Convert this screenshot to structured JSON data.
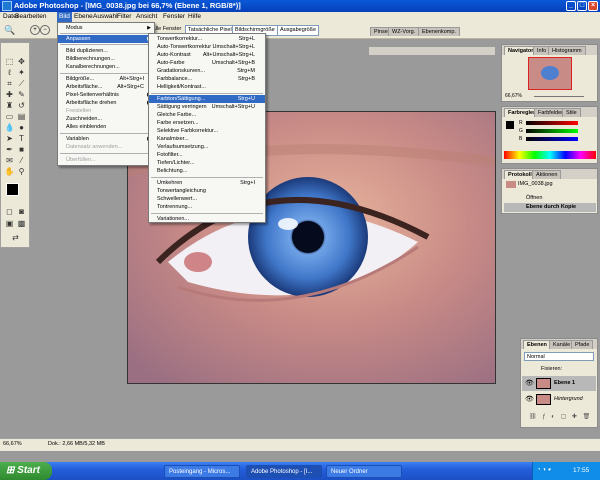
{
  "title": "Adobe Photoshop - [IMG_0038.jpg bei 66,7% (Ebene 1, RGB/8*)]",
  "window_controls": {
    "minimize": "_",
    "maximize": "□",
    "close": "×"
  },
  "menubar": [
    "Datei",
    "Bearbeiten",
    "Bild",
    "Ebene",
    "Auswahl",
    "Filter",
    "Ansicht",
    "Fenster",
    "Hilfe"
  ],
  "options_bar": {
    "all_windows": "Alle Fenster",
    "buttons": [
      "Tatsächliche Pixel",
      "Bildschirmgröße",
      "Ausgabegröße"
    ]
  },
  "image_menu": {
    "items": [
      {
        "label": "Modus",
        "shortcut": "",
        "submenu": true,
        "state": "normal"
      },
      {
        "label": "Anpassen",
        "shortcut": "",
        "submenu": true,
        "state": "highlighted"
      },
      {
        "label": "Bild duplizieren...",
        "shortcut": "",
        "state": "normal"
      },
      {
        "label": "Bildberechnungen...",
        "shortcut": "",
        "state": "normal"
      },
      {
        "label": "Kanalberechnungen...",
        "shortcut": "",
        "state": "normal"
      },
      {
        "label": "Bildgröße...",
        "shortcut": "Alt+Strg+I",
        "state": "normal"
      },
      {
        "label": "Arbeitsfläche...",
        "shortcut": "Alt+Strg+C",
        "state": "normal"
      },
      {
        "label": "Pixel-Seitenverhältnis",
        "shortcut": "",
        "submenu": true,
        "state": "normal"
      },
      {
        "label": "Arbeitsfläche drehen",
        "shortcut": "",
        "submenu": true,
        "state": "normal"
      },
      {
        "label": "Freistellen",
        "shortcut": "",
        "state": "disabled"
      },
      {
        "label": "Zuschneiden...",
        "shortcut": "",
        "state": "normal"
      },
      {
        "label": "Alles einblenden",
        "shortcut": "",
        "state": "normal"
      },
      {
        "label": "Variablen",
        "shortcut": "",
        "submenu": true,
        "state": "normal"
      },
      {
        "label": "Datensatz anwenden...",
        "shortcut": "",
        "state": "disabled"
      },
      {
        "label": "Überfüllen...",
        "shortcut": "",
        "state": "disabled"
      }
    ]
  },
  "adjust_menu": {
    "items": [
      {
        "label": "Tonwertkorrektur...",
        "shortcut": "Strg+L",
        "state": "normal"
      },
      {
        "label": "Auto-Tonwertkorrektur",
        "shortcut": "Umschalt+Strg+L",
        "state": "normal"
      },
      {
        "label": "Auto-Kontrast",
        "shortcut": "Alt+Umschalt+Strg+L",
        "state": "normal"
      },
      {
        "label": "Auto-Farbe",
        "shortcut": "Umschalt+Strg+B",
        "state": "normal"
      },
      {
        "label": "Gradationskurven...",
        "shortcut": "Strg+M",
        "state": "normal"
      },
      {
        "label": "Farbbalance...",
        "shortcut": "Strg+B",
        "state": "normal"
      },
      {
        "label": "Helligkeit/Kontrast...",
        "shortcut": "",
        "state": "normal"
      },
      {
        "label": "Farbton/Sättigung...",
        "shortcut": "Strg+U",
        "state": "highlighted"
      },
      {
        "label": "Sättigung verringern",
        "shortcut": "Umschalt+Strg+U",
        "state": "normal"
      },
      {
        "label": "Gleiche Farbe...",
        "shortcut": "",
        "state": "normal"
      },
      {
        "label": "Farbe ersetzen...",
        "shortcut": "",
        "state": "normal"
      },
      {
        "label": "Selektive Farbkorrektur...",
        "shortcut": "",
        "state": "normal"
      },
      {
        "label": "Kanalmixer...",
        "shortcut": "",
        "state": "normal"
      },
      {
        "label": "Verlaufsumsetzung...",
        "shortcut": "",
        "state": "normal"
      },
      {
        "label": "Fotofilter...",
        "shortcut": "",
        "state": "normal"
      },
      {
        "label": "Tiefen/Lichter...",
        "shortcut": "",
        "state": "normal"
      },
      {
        "label": "Belichtung...",
        "shortcut": "",
        "state": "normal"
      },
      {
        "label": "Umkehren",
        "shortcut": "Strg+I",
        "state": "normal"
      },
      {
        "label": "Tonwertangleichung",
        "shortcut": "",
        "state": "normal"
      },
      {
        "label": "Schwellenwert...",
        "shortcut": "",
        "state": "normal"
      },
      {
        "label": "Tontrennung...",
        "shortcut": "",
        "state": "normal"
      },
      {
        "label": "Variationen...",
        "shortcut": "",
        "state": "normal"
      }
    ]
  },
  "panels": {
    "top_tabs": [
      "Pinsel",
      "WZ-Vorg.",
      "Ebenenkomp."
    ],
    "navigator": {
      "tabs": [
        "Navigator",
        "Info",
        "Histogramm"
      ],
      "zoom": "66,67%"
    },
    "color": {
      "tabs": [
        "Farbregler",
        "Farbfelder",
        "Stile"
      ],
      "channels": [
        "R",
        "G",
        "B"
      ]
    },
    "history": {
      "tabs": [
        "Protokoll",
        "Aktionen"
      ],
      "snapshot": "IMG_0038.jpg",
      "steps": [
        "Öffnen",
        "Ebene durch Kopie"
      ]
    },
    "layers": {
      "tabs": [
        "Ebenen",
        "Kanäle",
        "Pfade"
      ],
      "blend_mode": "Normal",
      "lock_label": "Fixieren:",
      "layers": [
        {
          "name": "Ebene 1",
          "selected": true
        },
        {
          "name": "Hintergrund",
          "selected": false
        }
      ]
    }
  },
  "status": {
    "zoom": "66,67%",
    "doc": "Dok.: 2,66 MB/5,32 MB"
  },
  "taskbar": {
    "start": "Start",
    "tasks": [
      "Posteingang - Micros...",
      "Adobe Photoshop - [I...",
      "Neuer Ordner"
    ],
    "active_task": 1,
    "clock": "17:55"
  },
  "colors": {
    "title_blue": "#0a58d8",
    "highlight": "#316ac5",
    "menu_bg": "#f7f7f4",
    "taskbar": "#245edb",
    "start_green": "#3c9a3c"
  }
}
